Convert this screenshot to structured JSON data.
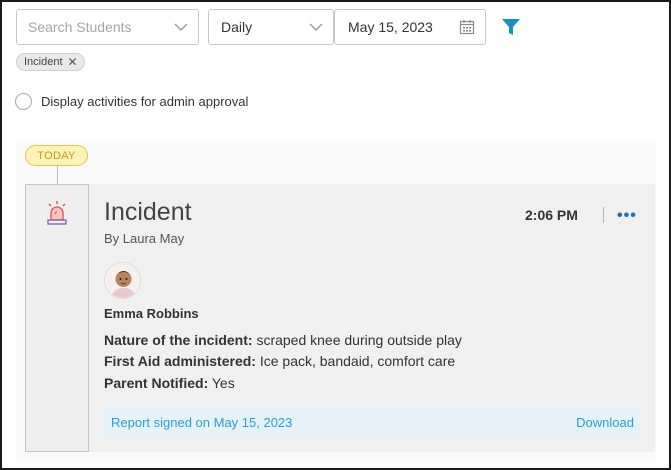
{
  "filters": {
    "search_placeholder": "Search Students",
    "period": "Daily",
    "date": "May 15, 2023",
    "active_chip": "Incident",
    "chip_remove": "✕"
  },
  "approval_toggle": {
    "label": "Display activities for admin approval"
  },
  "timeline": {
    "today_label": "TODAY"
  },
  "activity": {
    "title": "Incident",
    "author": "By Laura May",
    "time": "2:06 PM",
    "more": "•••",
    "student_name": "Emma Robbins",
    "fields": [
      {
        "label": "Nature of the incident:",
        "value": " scraped knee during outside play"
      },
      {
        "label": "First Aid administered:",
        "value": " Ice pack, bandaid, comfort care"
      },
      {
        "label": "Parent Notified:",
        "value": " Yes"
      }
    ],
    "report_status": "Report signed on May 15, 2023",
    "download_label": "Download"
  },
  "colors": {
    "accent": "#2a9fd6",
    "filter_icon": "#1a8fc4",
    "today_badge_bg": "#fff3b8",
    "today_badge_text": "#c79a16",
    "alarm_icon": "#e2524a"
  },
  "icons": [
    "chevron-down-icon",
    "calendar-icon",
    "filter-icon",
    "close-icon",
    "alarm-icon",
    "more-icon"
  ]
}
